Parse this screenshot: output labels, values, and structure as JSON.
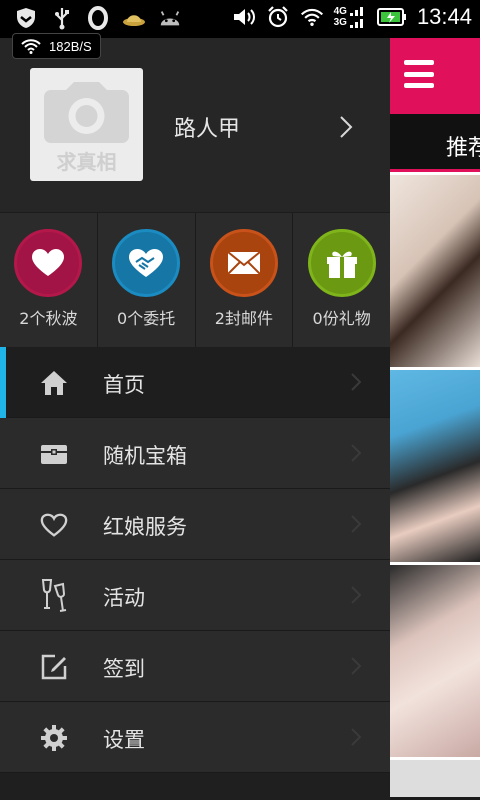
{
  "status_bar": {
    "time": "13:44",
    "network_4g": "4G",
    "network_3g": "3G",
    "icons": [
      "shield-icon",
      "usb-icon",
      "opera-icon",
      "hat-icon",
      "android-icon",
      "volume-icon",
      "alarm-icon",
      "wifi-icon",
      "battery-icon"
    ]
  },
  "net_speed": "182B/S",
  "profile": {
    "avatar_caption": "求真相",
    "username": "路人甲"
  },
  "stats": [
    {
      "label": "2个秋波",
      "icon": "heart-icon",
      "color": "#b4184a"
    },
    {
      "label": "0个委托",
      "icon": "handshake-heart-icon",
      "color": "#1b8cc2"
    },
    {
      "label": "2封邮件",
      "icon": "mail-icon",
      "color": "#c8521a"
    },
    {
      "label": "0份礼物",
      "icon": "gift-icon",
      "color": "#7fb51b"
    }
  ],
  "menu": [
    {
      "label": "首页",
      "icon": "home-icon",
      "active": true
    },
    {
      "label": "随机宝箱",
      "icon": "treasure-chest-icon"
    },
    {
      "label": "红娘服务",
      "icon": "heart-outline-icon"
    },
    {
      "label": "活动",
      "icon": "wine-glasses-icon"
    },
    {
      "label": "签到",
      "icon": "edit-checkin-icon"
    },
    {
      "label": "设置",
      "icon": "gear-icon"
    }
  ],
  "main": {
    "tab_label": "推荐",
    "header_color": "#e0115a"
  }
}
